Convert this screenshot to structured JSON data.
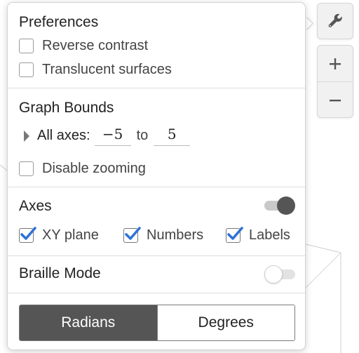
{
  "toolbar": {
    "settings_icon": "wrench-icon",
    "zoom_in_icon": "plus-icon",
    "zoom_out_icon": "minus-icon"
  },
  "popover": {
    "preferences": {
      "title": "Preferences",
      "reverse_contrast": {
        "label": "Reverse contrast",
        "checked": false
      },
      "translucent_surfaces": {
        "label": "Translucent surfaces",
        "checked": false
      }
    },
    "graph_bounds": {
      "title": "Graph Bounds",
      "all_axes_label": "All axes:",
      "min_value": "−5",
      "to_label": "to",
      "max_value": "5",
      "disable_zooming": {
        "label": "Disable zooming",
        "checked": false
      }
    },
    "axes": {
      "title": "Axes",
      "toggle_on": true,
      "xy_plane": {
        "label": "XY plane",
        "checked": true
      },
      "numbers": {
        "label": "Numbers",
        "checked": true
      },
      "labels": {
        "label": "Labels",
        "checked": true
      }
    },
    "braille": {
      "title": "Braille Mode",
      "toggle_on": false
    },
    "angle_mode": {
      "options": [
        "Radians",
        "Degrees"
      ],
      "selected": "Radians"
    }
  },
  "colors": {
    "check_blue": "#2f72d6",
    "active_segment": "#555555"
  }
}
